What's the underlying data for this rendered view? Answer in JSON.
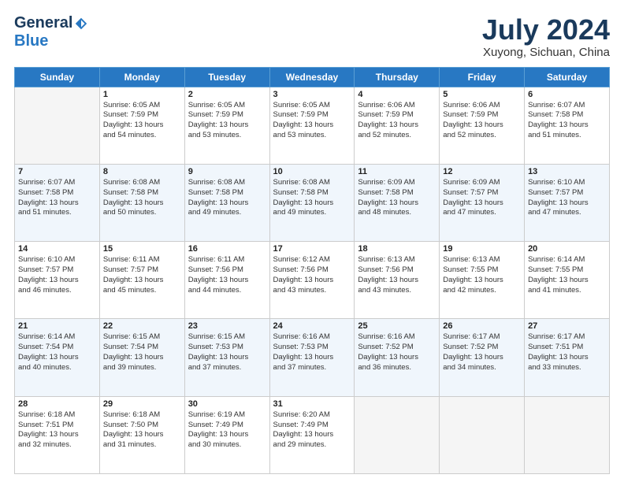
{
  "header": {
    "logo_general": "General",
    "logo_blue": "Blue",
    "title": "July 2024",
    "subtitle": "Xuyong, Sichuan, China"
  },
  "days_of_week": [
    "Sunday",
    "Monday",
    "Tuesday",
    "Wednesday",
    "Thursday",
    "Friday",
    "Saturday"
  ],
  "weeks": [
    [
      {
        "day": "",
        "empty": true
      },
      {
        "day": "1",
        "sunrise": "6:05 AM",
        "sunset": "7:59 PM",
        "daylight": "13 hours and 54 minutes."
      },
      {
        "day": "2",
        "sunrise": "6:05 AM",
        "sunset": "7:59 PM",
        "daylight": "13 hours and 53 minutes."
      },
      {
        "day": "3",
        "sunrise": "6:05 AM",
        "sunset": "7:59 PM",
        "daylight": "13 hours and 53 minutes."
      },
      {
        "day": "4",
        "sunrise": "6:06 AM",
        "sunset": "7:59 PM",
        "daylight": "13 hours and 52 minutes."
      },
      {
        "day": "5",
        "sunrise": "6:06 AM",
        "sunset": "7:59 PM",
        "daylight": "13 hours and 52 minutes."
      },
      {
        "day": "6",
        "sunrise": "6:07 AM",
        "sunset": "7:58 PM",
        "daylight": "13 hours and 51 minutes."
      }
    ],
    [
      {
        "day": "7",
        "sunrise": "6:07 AM",
        "sunset": "7:58 PM",
        "daylight": "13 hours and 51 minutes."
      },
      {
        "day": "8",
        "sunrise": "6:08 AM",
        "sunset": "7:58 PM",
        "daylight": "13 hours and 50 minutes."
      },
      {
        "day": "9",
        "sunrise": "6:08 AM",
        "sunset": "7:58 PM",
        "daylight": "13 hours and 49 minutes."
      },
      {
        "day": "10",
        "sunrise": "6:08 AM",
        "sunset": "7:58 PM",
        "daylight": "13 hours and 49 minutes."
      },
      {
        "day": "11",
        "sunrise": "6:09 AM",
        "sunset": "7:58 PM",
        "daylight": "13 hours and 48 minutes."
      },
      {
        "day": "12",
        "sunrise": "6:09 AM",
        "sunset": "7:57 PM",
        "daylight": "13 hours and 47 minutes."
      },
      {
        "day": "13",
        "sunrise": "6:10 AM",
        "sunset": "7:57 PM",
        "daylight": "13 hours and 47 minutes."
      }
    ],
    [
      {
        "day": "14",
        "sunrise": "6:10 AM",
        "sunset": "7:57 PM",
        "daylight": "13 hours and 46 minutes."
      },
      {
        "day": "15",
        "sunrise": "6:11 AM",
        "sunset": "7:57 PM",
        "daylight": "13 hours and 45 minutes."
      },
      {
        "day": "16",
        "sunrise": "6:11 AM",
        "sunset": "7:56 PM",
        "daylight": "13 hours and 44 minutes."
      },
      {
        "day": "17",
        "sunrise": "6:12 AM",
        "sunset": "7:56 PM",
        "daylight": "13 hours and 43 minutes."
      },
      {
        "day": "18",
        "sunrise": "6:13 AM",
        "sunset": "7:56 PM",
        "daylight": "13 hours and 43 minutes."
      },
      {
        "day": "19",
        "sunrise": "6:13 AM",
        "sunset": "7:55 PM",
        "daylight": "13 hours and 42 minutes."
      },
      {
        "day": "20",
        "sunrise": "6:14 AM",
        "sunset": "7:55 PM",
        "daylight": "13 hours and 41 minutes."
      }
    ],
    [
      {
        "day": "21",
        "sunrise": "6:14 AM",
        "sunset": "7:54 PM",
        "daylight": "13 hours and 40 minutes."
      },
      {
        "day": "22",
        "sunrise": "6:15 AM",
        "sunset": "7:54 PM",
        "daylight": "13 hours and 39 minutes."
      },
      {
        "day": "23",
        "sunrise": "6:15 AM",
        "sunset": "7:53 PM",
        "daylight": "13 hours and 37 minutes."
      },
      {
        "day": "24",
        "sunrise": "6:16 AM",
        "sunset": "7:53 PM",
        "daylight": "13 hours and 37 minutes."
      },
      {
        "day": "25",
        "sunrise": "6:16 AM",
        "sunset": "7:52 PM",
        "daylight": "13 hours and 36 minutes."
      },
      {
        "day": "26",
        "sunrise": "6:17 AM",
        "sunset": "7:52 PM",
        "daylight": "13 hours and 34 minutes."
      },
      {
        "day": "27",
        "sunrise": "6:17 AM",
        "sunset": "7:51 PM",
        "daylight": "13 hours and 33 minutes."
      }
    ],
    [
      {
        "day": "28",
        "sunrise": "6:18 AM",
        "sunset": "7:51 PM",
        "daylight": "13 hours and 32 minutes."
      },
      {
        "day": "29",
        "sunrise": "6:18 AM",
        "sunset": "7:50 PM",
        "daylight": "13 hours and 31 minutes."
      },
      {
        "day": "30",
        "sunrise": "6:19 AM",
        "sunset": "7:49 PM",
        "daylight": "13 hours and 30 minutes."
      },
      {
        "day": "31",
        "sunrise": "6:20 AM",
        "sunset": "7:49 PM",
        "daylight": "13 hours and 29 minutes."
      },
      {
        "day": "",
        "empty": true
      },
      {
        "day": "",
        "empty": true
      },
      {
        "day": "",
        "empty": true
      }
    ]
  ]
}
